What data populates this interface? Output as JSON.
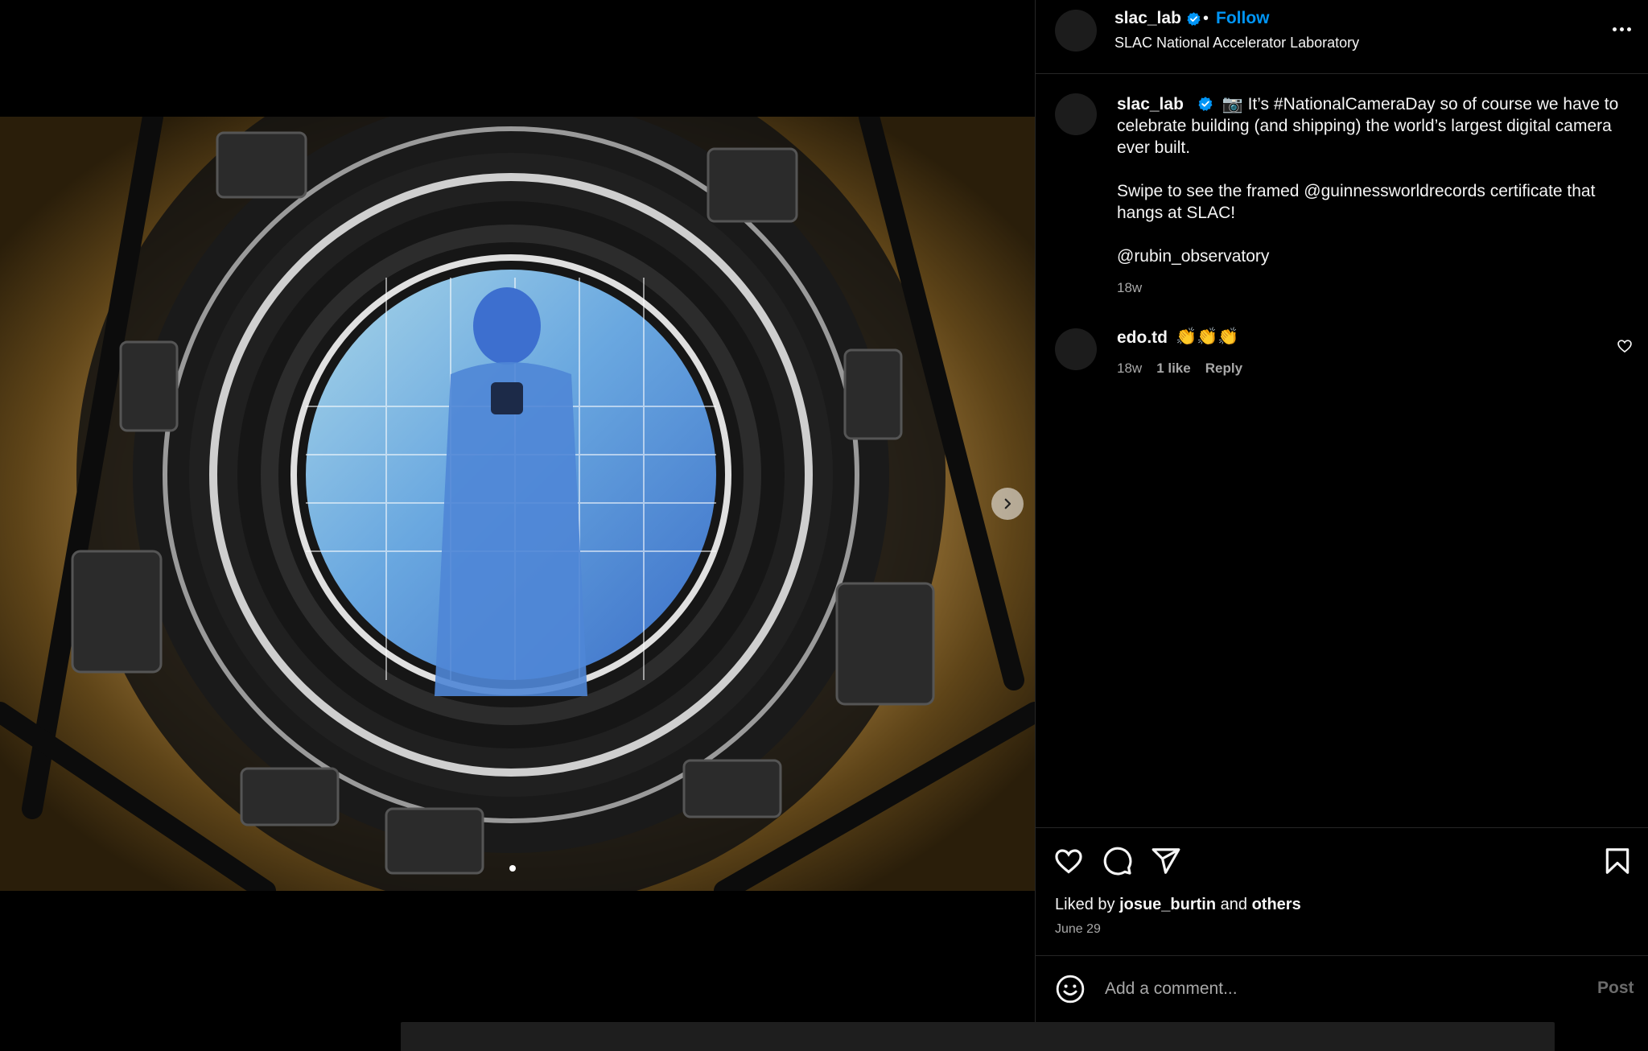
{
  "media": {
    "next_icon": "chevron-right-icon"
  },
  "header": {
    "username": "slac_lab",
    "separator": "•",
    "follow_label": "Follow",
    "subtitle": "SLAC National Accelerator Laboratory",
    "more_icon": "more-options-icon"
  },
  "caption": {
    "username": "slac_lab",
    "emoji": "📷",
    "line1": "It’s #NationalCameraDay so of course we have to celebrate building (and shipping) the world’s largest digital camera ever built.",
    "line2": "Swipe to see the framed @guinnessworldrecords certificate that hangs at SLAC!",
    "line3": "@rubin_observatory",
    "time": "18w"
  },
  "comments": [
    {
      "username": "edo.td",
      "text": "👏👏👏",
      "time": "18w",
      "likes": "1 like",
      "reply_label": "Reply"
    }
  ],
  "actions": {
    "like_icon": "heart-icon",
    "comment_icon": "comment-icon",
    "share_icon": "share-icon",
    "save_icon": "bookmark-icon",
    "liked_by_prefix": "Liked by",
    "liked_by_user": "josue_burtin",
    "liked_by_and": "and",
    "liked_by_others": "others",
    "date": "June 29"
  },
  "comment_box": {
    "placeholder": "Add a comment...",
    "post_label": "Post",
    "emoji_icon": "emoji-icon"
  },
  "colors": {
    "background": "#000000",
    "text": "#f5f5f5",
    "muted": "#a8a8a8",
    "accent": "#0095f6"
  }
}
